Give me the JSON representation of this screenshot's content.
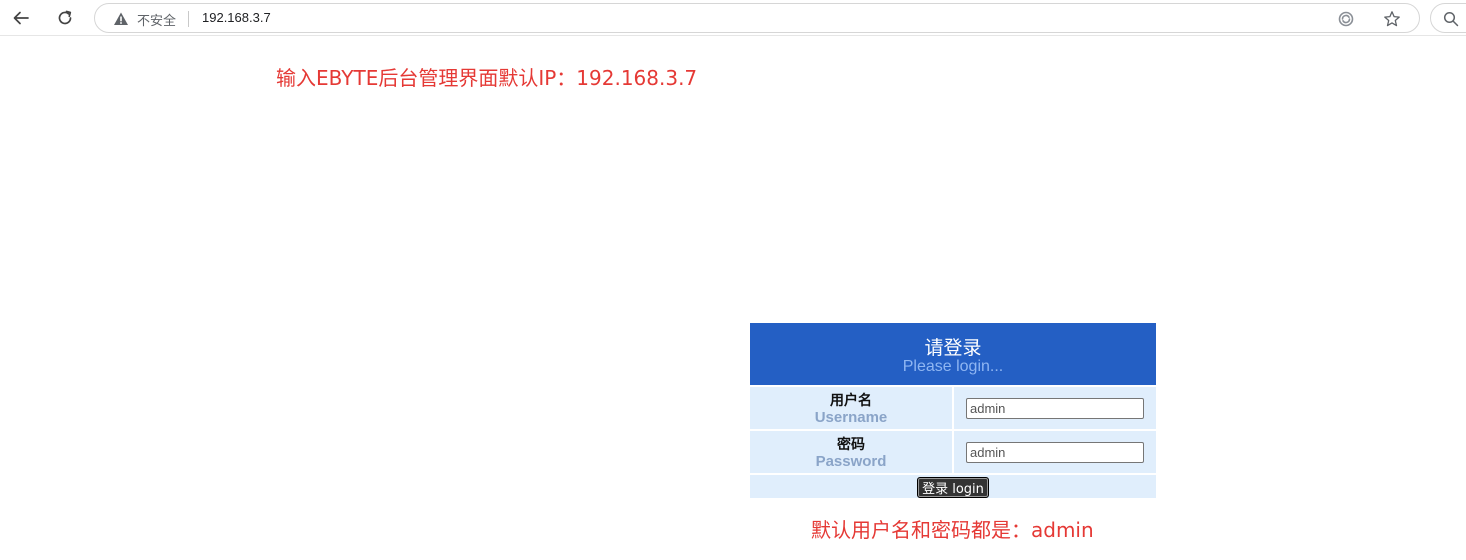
{
  "browser": {
    "security_label": "不安全",
    "url": "192.168.3.7",
    "icons": {
      "back": "back-arrow-icon",
      "refresh": "refresh-icon",
      "warning": "warning-icon",
      "translate": "translate-icon",
      "bookmark": "star-icon",
      "search": "search-icon"
    }
  },
  "annotations": {
    "top": "输入EBYTE后台管理界面默认IP：192.168.3.7",
    "bottom": "默认用户名和密码都是：admin",
    "color": "#e53935"
  },
  "login": {
    "title": "请登录",
    "subtitle": "Please login...",
    "username_label_cn": "用户名",
    "username_label_en": "Username",
    "username_value": "admin",
    "password_label_cn": "密码",
    "password_label_en": "Password",
    "password_value": "admin",
    "submit_label": "登录 login",
    "header_color": "#245fc4",
    "row_color": "#e0eefc"
  }
}
